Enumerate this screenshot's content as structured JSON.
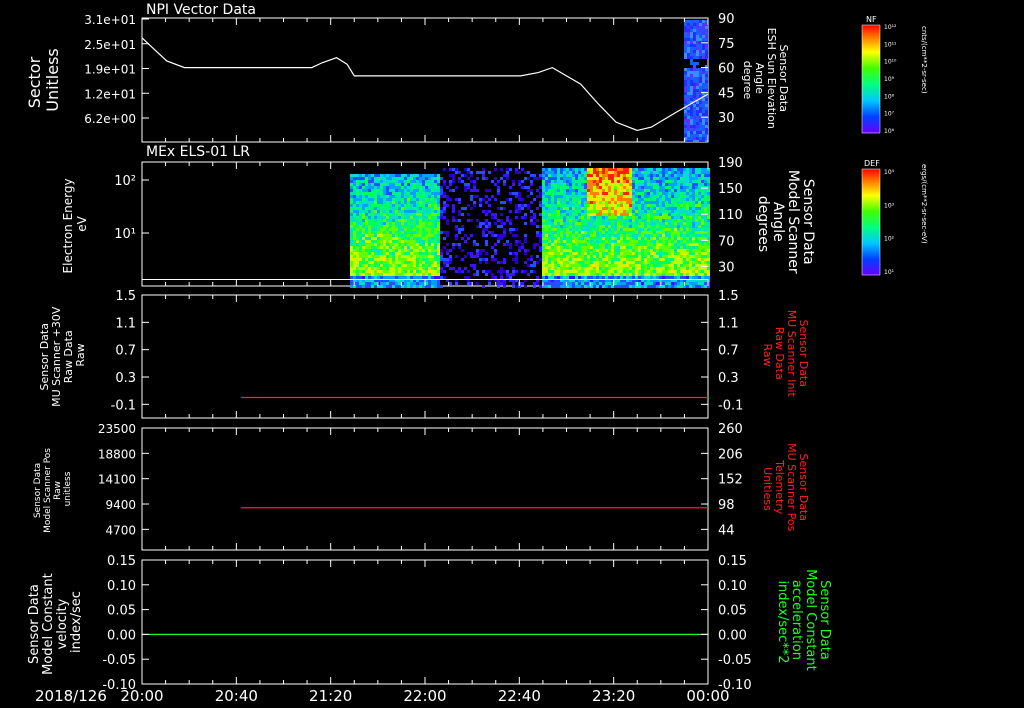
{
  "colors": {
    "background": "#000000",
    "frame": "#ffffff",
    "trace_white": "#ffffff",
    "trace_red": "#ff2020",
    "trace_green": "#20ff20",
    "label_red": "#ff2020",
    "label_green": "#20ff20"
  },
  "chart_data": [
    {
      "type": "line",
      "title": "NPI Vector Data",
      "ylabel_left": [
        "Sector",
        "Unitless"
      ],
      "ylabel_right": [
        "Sensor Data",
        "ESH Sun Elevation",
        "Angle",
        "degree"
      ],
      "ylim_right": [
        15,
        90
      ],
      "yticks_left": [
        "3.1e+01",
        "2.5e+01",
        "1.9e+01",
        "1.2e+01",
        "6.2e+00"
      ],
      "yticks_right": [
        "90",
        "75",
        "60",
        "45",
        "30"
      ],
      "x_hours": [
        0,
        0.15,
        0.35,
        0.6,
        1.0,
        1.5,
        2.0,
        2.4,
        2.55,
        2.75,
        2.9,
        3.0,
        3.3,
        3.75,
        3.95,
        4.15,
        4.35,
        4.6,
        4.75,
        5.0,
        5.35,
        5.6,
        5.8,
        6.2,
        6.45,
        6.7,
        7.0,
        7.2,
        7.55,
        8.0
      ],
      "series": [
        {
          "values": [
            78,
            72,
            64,
            60,
            60,
            60,
            60,
            60,
            63,
            66,
            62,
            55,
            55,
            55,
            55,
            55,
            55,
            55,
            55,
            55,
            55,
            57,
            60,
            50,
            38,
            27,
            22,
            24,
            33,
            44
          ]
        }
      ],
      "colorbar": {
        "label": "NF",
        "unit": "cnts/(cm**2-sr-sec)",
        "ticks": [
          "10¹²",
          "10¹¹",
          "10¹⁰",
          "10⁹",
          "10⁸",
          "10⁷",
          "10⁶"
        ]
      }
    },
    {
      "type": "heatmap",
      "title": "MEx ELS-01 LR",
      "ylabel_left": [
        "Electron Energy",
        "eV"
      ],
      "ylabel_right": [
        "Sensor Data",
        "Model Scanner",
        "Angle",
        "degrees"
      ],
      "yticks_left": [
        "10²",
        "10¹"
      ],
      "yticks_right": [
        "190",
        "150",
        "110",
        "70",
        "30"
      ],
      "ylim_right": [
        0,
        190
      ],
      "angle_line_value": 10,
      "colorbar": {
        "label": "DEF",
        "unit": "ergs/(cm**2-sr-sec-eV)",
        "ticks": [
          "10⁴",
          "10³",
          "10²",
          "10¹"
        ]
      }
    },
    {
      "type": "line",
      "ylabel_left": [
        "Sensor Data",
        "MU Scanner +30V",
        "Raw Data",
        "Raw"
      ],
      "ylabel_right": [
        "Sensor Data",
        "MU Scanner Init",
        "Raw Data",
        "Raw"
      ],
      "ylim": [
        -0.3,
        1.5
      ],
      "yticks": [
        "1.5",
        "1.1",
        "0.7",
        "0.3",
        "-0.1"
      ],
      "ytick_values": [
        1.5,
        1.1,
        0.7,
        0.3,
        -0.1
      ],
      "series": [
        {
          "color": "red",
          "x_start_hours": 1.4,
          "x_end_hours": 8.0,
          "value": 0
        }
      ]
    },
    {
      "type": "line",
      "ylabel_left": [
        "Sensor Data",
        "Model Scanner Pos",
        "Raw",
        "unitless"
      ],
      "ylabel_right": [
        "Sensor Data",
        "MU Scanner Pos",
        "Telemetry",
        "Unitless"
      ],
      "yticks_left": [
        "23500",
        "18800",
        "14100",
        "9400",
        "4700"
      ],
      "yticks_right": [
        "260",
        "206",
        "152",
        "98",
        "44"
      ],
      "ylim_right": [
        0,
        260
      ],
      "yticks_right_values": [
        260,
        206,
        152,
        98,
        44
      ],
      "series": [
        {
          "color": "red",
          "x_start_hours": 1.4,
          "x_end_hours": 8.0,
          "value": 90
        }
      ]
    },
    {
      "type": "line",
      "ylabel_left": [
        "Sensor Data",
        "Model Constant",
        "velocity",
        "index/sec"
      ],
      "ylabel_right": [
        "Sensor Data",
        "Model Constant",
        "acceleration",
        "index/sec**2"
      ],
      "ylim": [
        -0.1,
        0.15
      ],
      "yticks": [
        "0.15",
        "0.10",
        "0.05",
        "0.00",
        "-0.05",
        "-0.10"
      ],
      "ytick_values": [
        0.15,
        0.1,
        0.05,
        0.0,
        -0.05,
        -0.1
      ],
      "series": [
        {
          "color": "green",
          "x_start_hours": 0,
          "x_end_hours": 8.0,
          "value": 0
        }
      ]
    }
  ],
  "x_axis": {
    "date_label": "2018/126",
    "ticks": [
      "20:00",
      "20:40",
      "21:20",
      "22:00",
      "22:40",
      "23:20",
      "00:00"
    ],
    "range_hours": [
      0,
      8
    ]
  }
}
